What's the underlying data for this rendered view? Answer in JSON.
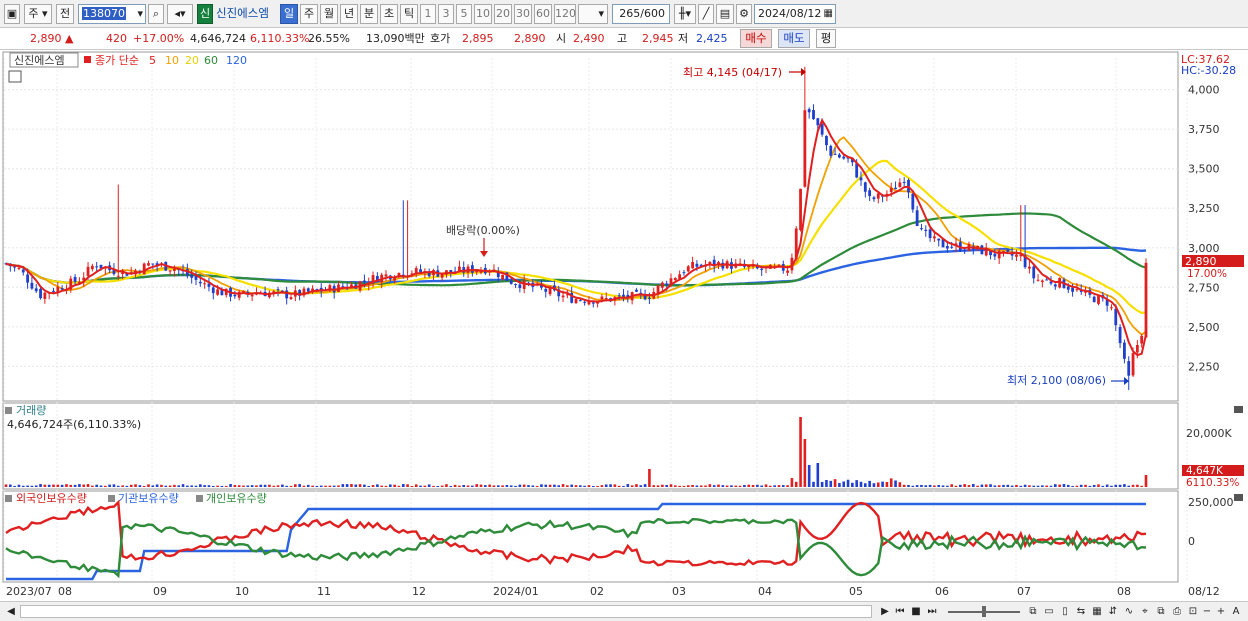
{
  "toolbar": {
    "market": "주",
    "prev": "전",
    "code": "138070",
    "badge": "신",
    "stock_name": "신진에스엠",
    "periods": [
      "일",
      "주",
      "월",
      "년",
      "분",
      "초",
      "틱"
    ],
    "active_period": "일",
    "intervals": [
      "1",
      "3",
      "5",
      "10",
      "20",
      "30",
      "60",
      "120"
    ],
    "count": "265/600",
    "date": "2024/08/12"
  },
  "quote": {
    "price": "2,890",
    "change": "420",
    "change_pct": "+17.00%",
    "volume": "4,646,724",
    "vol_ratio": "6,110.33%",
    "turnover": "26.55%",
    "amount": "13,090백만",
    "ask_label": "호가",
    "ask1": "2,895",
    "bid1": "2,890",
    "open_label": "시",
    "open": "2,490",
    "high_label": "고",
    "high": "2,945",
    "low_label": "저",
    "low": "2,425",
    "buy_label": "매수",
    "sell_label": "매도",
    "avg_label": "평"
  },
  "price_panel": {
    "stock": "신진에스엠",
    "legend_prefix": "종가 단순",
    "ma": [
      {
        "period": "5",
        "color": "#e02020"
      },
      {
        "period": "10",
        "color": "#f0a000"
      },
      {
        "period": "20",
        "color": "#f5e000"
      },
      {
        "period": "60",
        "color": "#2e8b3a"
      },
      {
        "period": "120",
        "color": "#2b63e0"
      }
    ],
    "lc": "LC:37.62",
    "hc": "HC:-30.28",
    "y_ticks": [
      "4,000",
      "3,750",
      "3,500",
      "3,250",
      "3,000",
      "2,750",
      "2,500",
      "2,250"
    ],
    "current_price": "2,890",
    "current_pct": "17.00%",
    "high_note": "최고 4,145 (04/17)",
    "low_note": "최저 2,100 (08/06)",
    "dividend_note": "배당락(0.00%)"
  },
  "volume_panel": {
    "title": "거래량",
    "value": "4,646,724주(6,110.33%)",
    "y_tick": "20,000K",
    "current": "4,647K",
    "current_pct": "6110.33%"
  },
  "holding_panel": {
    "foreign": "외국인보유수량",
    "inst": "기관보유수량",
    "indiv": "개인보유수량",
    "y_ticks": [
      "250,000",
      "0"
    ]
  },
  "x_axis": [
    "2023/07",
    "08",
    "09",
    "10",
    "11",
    "12",
    "2024/01",
    "02",
    "03",
    "04",
    "05",
    "06",
    "07",
    "08",
    "08/12"
  ],
  "chart_data": {
    "type": "candlestick",
    "ylim": [
      2050,
      4200
    ],
    "series_close_approx": [
      {
        "month": "2023/07",
        "close": 2900
      },
      {
        "month": "2023/08",
        "close": 2850
      },
      {
        "month": "2023/09",
        "close": 2900
      },
      {
        "month": "2023/10",
        "close": 2700
      },
      {
        "month": "2023/11",
        "close": 2820
      },
      {
        "month": "2023/12",
        "close": 2870
      },
      {
        "month": "2024/01",
        "close": 2800
      },
      {
        "month": "2024/02",
        "close": 2680
      },
      {
        "month": "2024/03",
        "close": 2900
      },
      {
        "month": "2024/04",
        "close": 3700
      },
      {
        "month": "2024/05",
        "close": 3500
      },
      {
        "month": "2024/06",
        "close": 3000
      },
      {
        "month": "2024/07",
        "close": 2750
      },
      {
        "month": "2024/08",
        "close": 2890
      }
    ]
  }
}
